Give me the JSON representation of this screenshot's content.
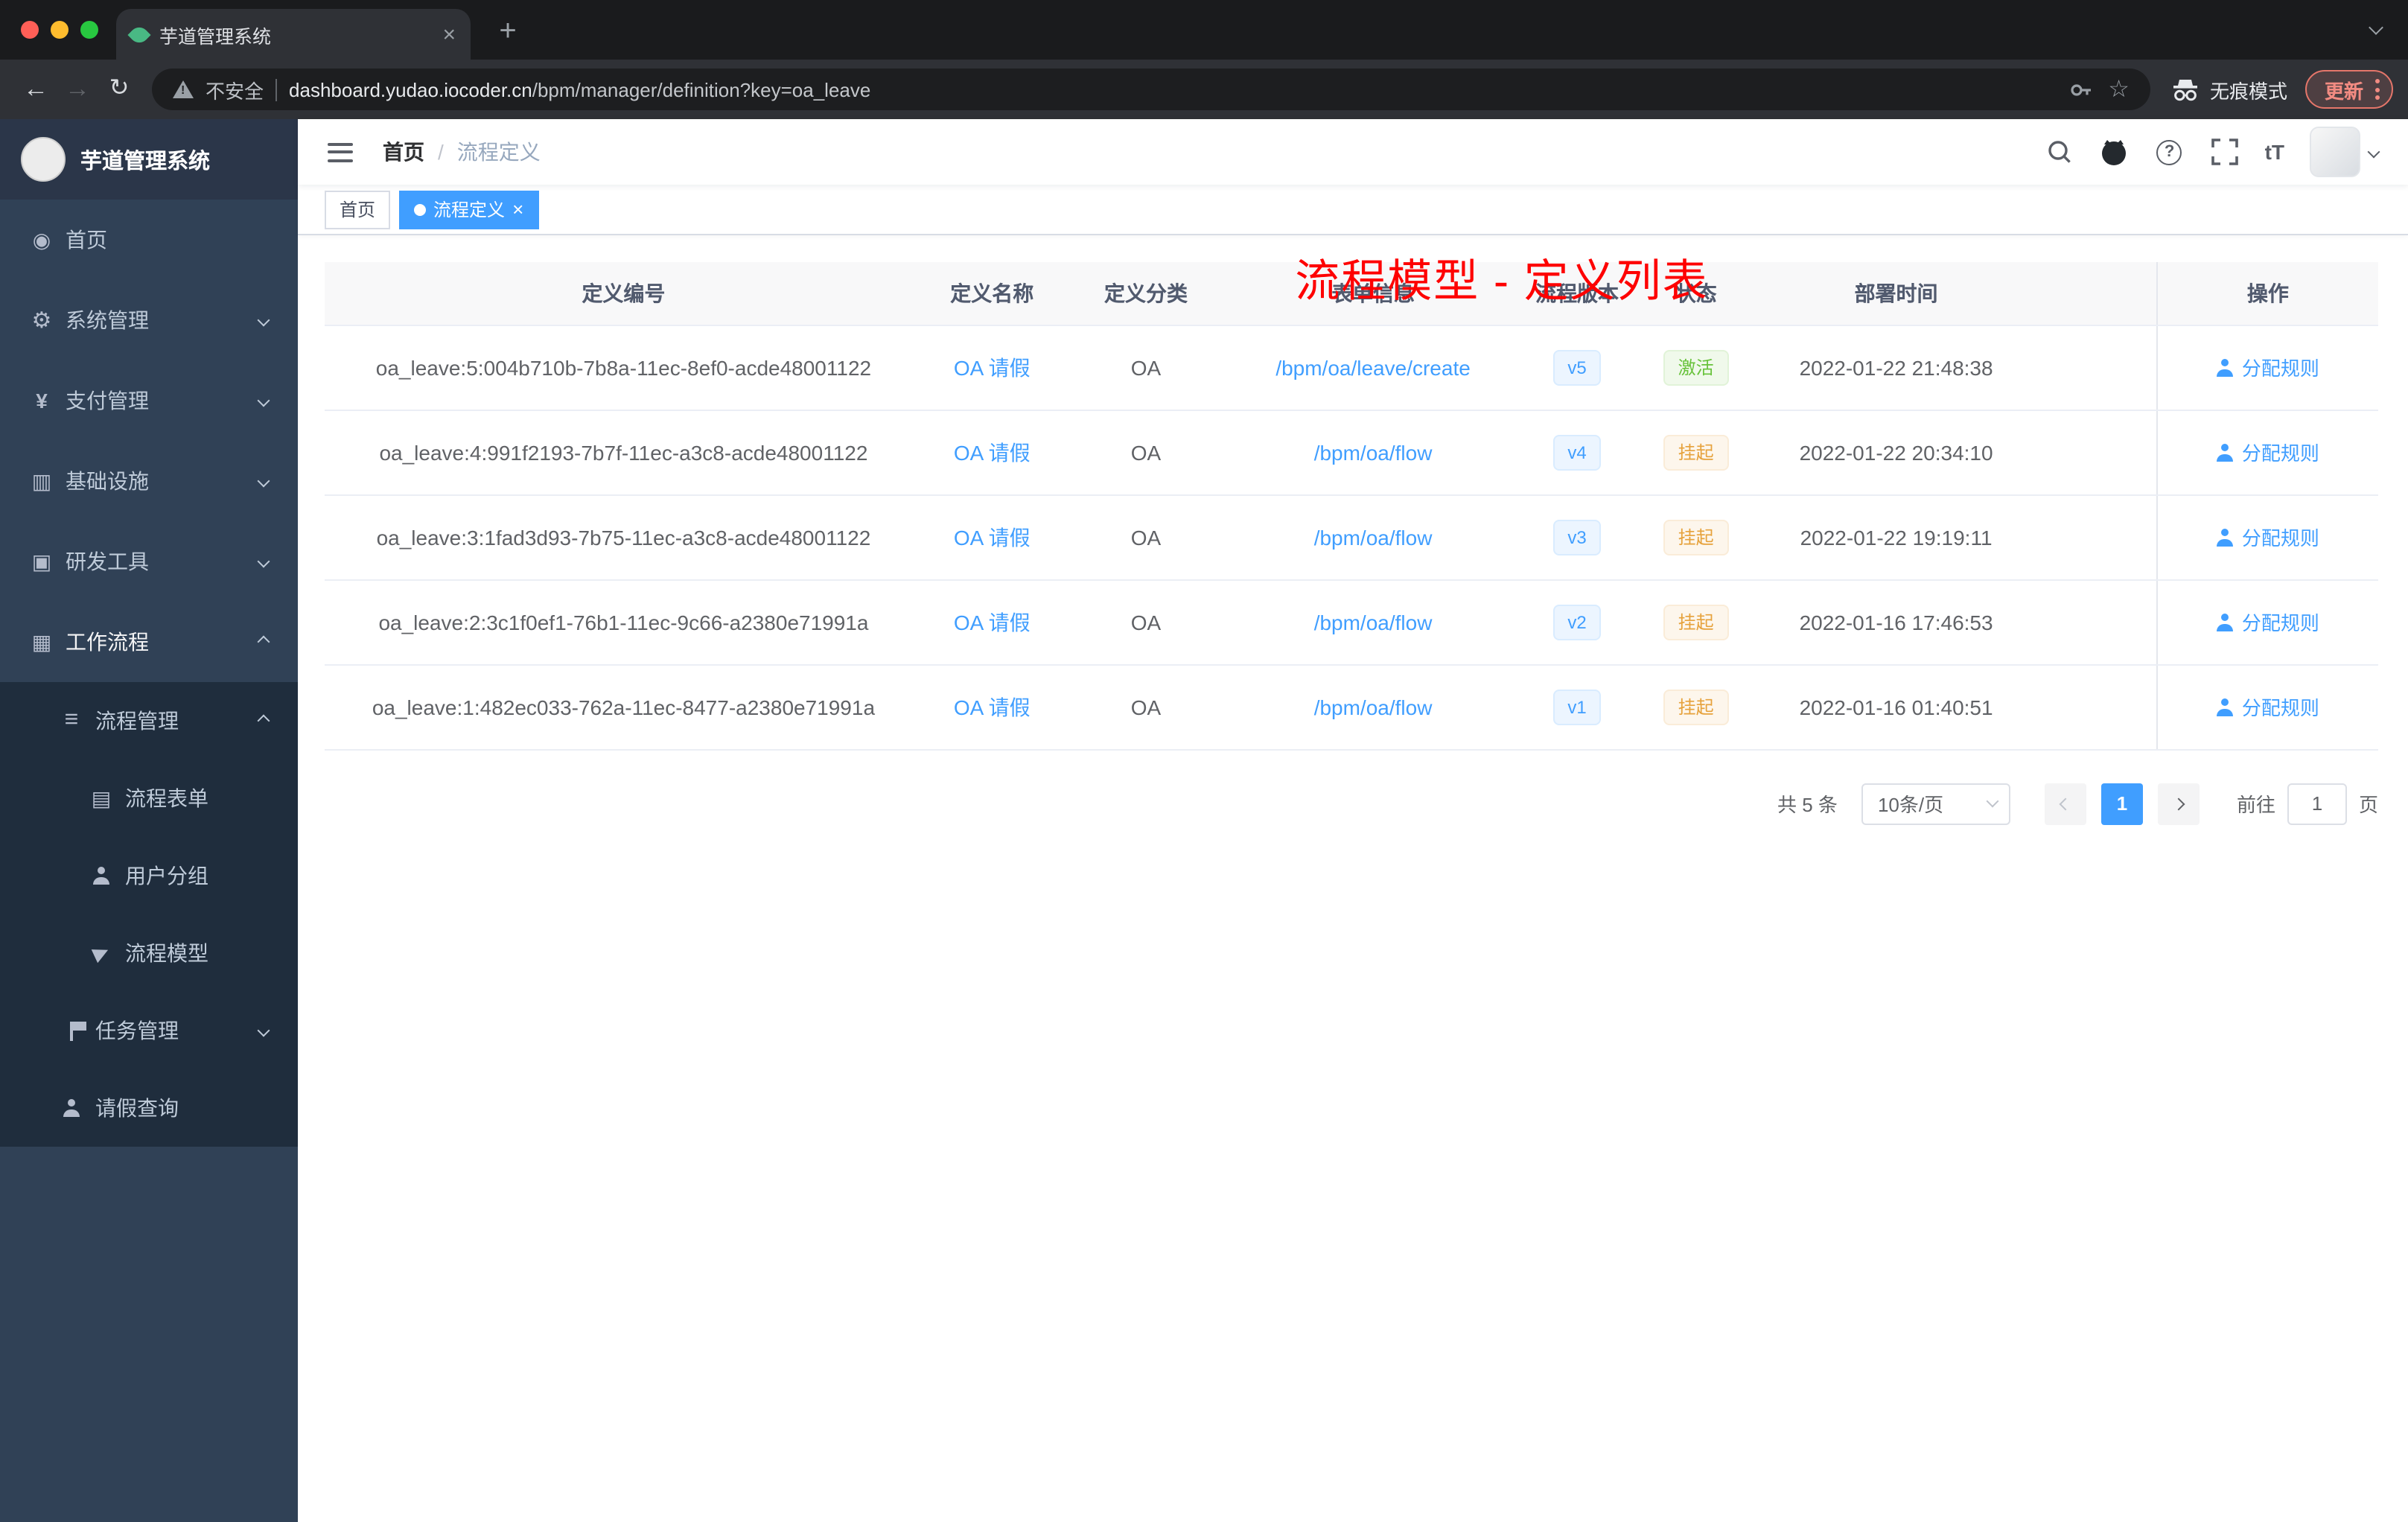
{
  "browser": {
    "tab_title": "芋道管理系统",
    "security_label": "不安全",
    "url_domain": "dashboard.yudao.iocoder.cn",
    "url_path": "/bpm/manager/definition?key=oa_leave",
    "incognito_label": "无痕模式",
    "update_label": "更新"
  },
  "sidebar": {
    "logo_title": "芋道管理系统",
    "items": [
      {
        "label": "首页"
      },
      {
        "label": "系统管理"
      },
      {
        "label": "支付管理"
      },
      {
        "label": "基础设施"
      },
      {
        "label": "研发工具"
      },
      {
        "label": "工作流程"
      }
    ],
    "workflow": {
      "process_mgmt": {
        "label": "流程管理"
      },
      "process_children": [
        {
          "label": "流程表单"
        },
        {
          "label": "用户分组"
        },
        {
          "label": "流程模型"
        }
      ],
      "task_mgmt": {
        "label": "任务管理"
      },
      "leave_query": {
        "label": "请假查询"
      }
    }
  },
  "navbar": {
    "breadcrumb": {
      "home": "首页",
      "separator": "/",
      "current": "流程定义"
    },
    "annotation": "流程模型 - 定义列表",
    "size_icon_label": "tT"
  },
  "tags_view": {
    "home": "首页",
    "active": "流程定义"
  },
  "table": {
    "headers": [
      "定义编号",
      "定义名称",
      "定义分类",
      "表单信息",
      "流程版本",
      "状态",
      "部署时间",
      "操作"
    ],
    "rows": [
      {
        "id": "oa_leave:5:004b710b-7b8a-11ec-8ef0-acde48001122",
        "name": "OA 请假",
        "category": "OA",
        "form": "/bpm/oa/leave/create",
        "version": "v5",
        "status": "激活",
        "deploy_time": "2022-01-22 21:48:38",
        "action": "分配规则"
      },
      {
        "id": "oa_leave:4:991f2193-7b7f-11ec-a3c8-acde48001122",
        "name": "OA 请假",
        "category": "OA",
        "form": "/bpm/oa/flow",
        "version": "v4",
        "status": "挂起",
        "deploy_time": "2022-01-22 20:34:10",
        "action": "分配规则"
      },
      {
        "id": "oa_leave:3:1fad3d93-7b75-11ec-a3c8-acde48001122",
        "name": "OA 请假",
        "category": "OA",
        "form": "/bpm/oa/flow",
        "version": "v3",
        "status": "挂起",
        "deploy_time": "2022-01-22 19:19:11",
        "action": "分配规则"
      },
      {
        "id": "oa_leave:2:3c1f0ef1-76b1-11ec-9c66-a2380e71991a",
        "name": "OA 请假",
        "category": "OA",
        "form": "/bpm/oa/flow",
        "version": "v2",
        "status": "挂起",
        "deploy_time": "2022-01-16 17:46:53",
        "action": "分配规则"
      },
      {
        "id": "oa_leave:1:482ec033-762a-11ec-8477-a2380e71991a",
        "name": "OA 请假",
        "category": "OA",
        "form": "/bpm/oa/flow",
        "version": "v1",
        "status": "挂起",
        "deploy_time": "2022-01-16 01:40:51",
        "action": "分配规则"
      }
    ]
  },
  "pagination": {
    "total": "共 5 条",
    "page_size": "10条/页",
    "page": "1",
    "goto_label": "前往",
    "goto_value": "1",
    "page_unit": "页"
  },
  "colors": {
    "primary": "#409eff",
    "success": "#67c23a",
    "warning": "#e6a23c",
    "annotation_red": "#fe0000",
    "sidebar_bg": "#304156",
    "submenu_bg": "#1f2d3d"
  }
}
